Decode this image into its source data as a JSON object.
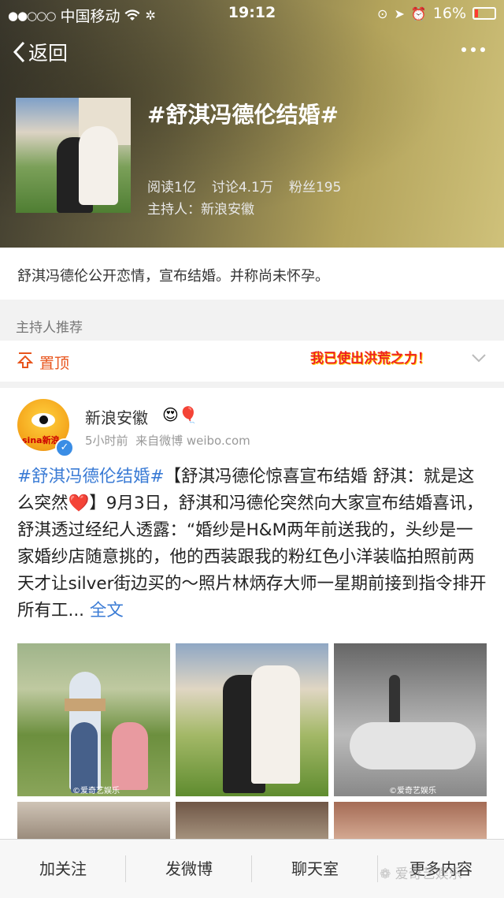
{
  "status_bar": {
    "carrier": "中国移动",
    "time": "19:12",
    "battery": "16%"
  },
  "nav": {
    "back_label": "返回"
  },
  "topic": {
    "title": "#舒淇冯德伦结婚#",
    "reads": "阅读1亿",
    "discussions": "讨论4.1万",
    "fans": "粉丝195",
    "host": "主持人：新浪安徽",
    "summary": "舒淇冯德伦公开恋情，宣布结婚。并称尚未怀孕。"
  },
  "section": {
    "label": "主持人推荐",
    "pinned_label": "置顶",
    "banner": "我已使出洪荒之力！"
  },
  "post": {
    "author": "新浪安徽",
    "time": "5小时前",
    "source": "来自微博 weibo.com",
    "hashtag": "#舒淇冯德伦结婚#",
    "text_1": "【舒淇冯德伦惊喜宣布结婚 舒淇：就是这么突然",
    "heart": "❤️",
    "text_2": "】9月3日，舒淇和冯德伦突然向大家宣布结婚喜讯，舒淇透过经纪人透露：“婚纱是H&M两年前送我的，头纱是一家婚纱店随意挑的，他的西装跟我的粉红色小洋装临拍照前两天才让silver街边买的～照片林炳存大师一星期前接到指令排开所有工...",
    "full_text": "全文",
    "avatar_brand": "sina新浪",
    "image_caption": "©爱奇艺娱乐"
  },
  "tabs": [
    {
      "label": "加关注"
    },
    {
      "label": "发微博"
    },
    {
      "label": "聊天室"
    },
    {
      "label": "更多内容"
    }
  ],
  "watermark": "爱奇艺娱乐"
}
